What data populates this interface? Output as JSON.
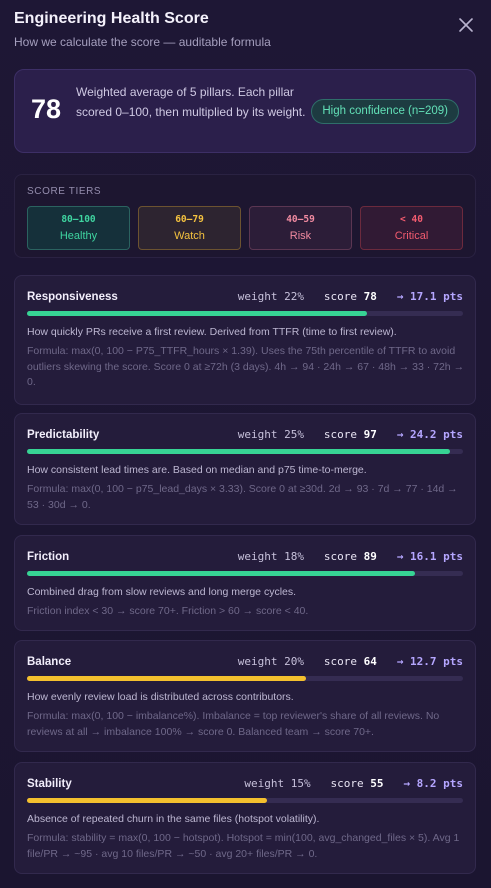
{
  "header": {
    "title": "Engineering Health Score",
    "subtitle": "How we calculate the score — auditable formula"
  },
  "summary": {
    "score": "78",
    "text": "Weighted average of 5 pillars. Each pillar scored 0–100, then multiplied by its weight.",
    "confidence": "High confidence (n=209)"
  },
  "tiers": {
    "label": "SCORE TIERS",
    "items": [
      {
        "range": "80–100",
        "name": "Healthy"
      },
      {
        "range": "60–79",
        "name": "Watch"
      },
      {
        "range": "40–59",
        "name": "Risk"
      },
      {
        "range": "< 40",
        "name": "Critical"
      }
    ]
  },
  "pillars": [
    {
      "name": "Responsiveness",
      "weight": "weight 22%",
      "score_label": "score",
      "score": "78",
      "pts": "→ 17.1 pts",
      "score_fraction": 0.78,
      "color": "#37d394",
      "description": "How quickly PRs receive a first review. Derived from TTFR (time to first review).",
      "formula": "Formula: max(0, 100 − P75_TTFR_hours × 1.39). Uses the 75th percentile of TTFR to avoid outliers skewing the score. Score 0 at ≥72h (3 days). 4h → 94 · 24h → 67 · 48h → 33 · 72h → 0."
    },
    {
      "name": "Predictability",
      "weight": "weight 25%",
      "score_label": "score",
      "score": "97",
      "pts": "→ 24.2 pts",
      "score_fraction": 0.97,
      "color": "#37d394",
      "description": "How consistent lead times are. Based on median and p75 time-to-merge.",
      "formula": "Formula: max(0, 100 − p75_lead_days × 3.33). Score 0 at ≥30d. 2d → 93 · 7d → 77 · 14d → 53 · 30d → 0."
    },
    {
      "name": "Friction",
      "weight": "weight 18%",
      "score_label": "score",
      "score": "89",
      "pts": "→ 16.1 pts",
      "score_fraction": 0.89,
      "color": "#37d394",
      "description": "Combined drag from slow reviews and long merge cycles.",
      "formula": "Friction index < 30 → score 70+. Friction > 60 → score < 40."
    },
    {
      "name": "Balance",
      "weight": "weight 20%",
      "score_label": "score",
      "score": "64",
      "pts": "→ 12.7 pts",
      "score_fraction": 0.64,
      "color": "#f4c02e",
      "description": "How evenly review load is distributed across contributors.",
      "formula": "Formula: max(0, 100 − imbalance%). Imbalance = top reviewer's share of all reviews. No reviews at all → imbalance 100% → score 0. Balanced team → score 70+."
    },
    {
      "name": "Stability",
      "weight": "weight 15%",
      "score_label": "score",
      "score": "55",
      "pts": "→ 8.2 pts",
      "score_fraction": 0.55,
      "color": "#f4c02e",
      "description": "Absence of repeated churn in the same files (hotspot volatility).",
      "formula": "Formula: stability = max(0, 100 − hotspot). Hotspot = min(100, avg_changed_files × 5). Avg 1 file/PR → ~95 · avg 10 files/PR → ~50 · avg 20+ files/PR → 0."
    }
  ]
}
